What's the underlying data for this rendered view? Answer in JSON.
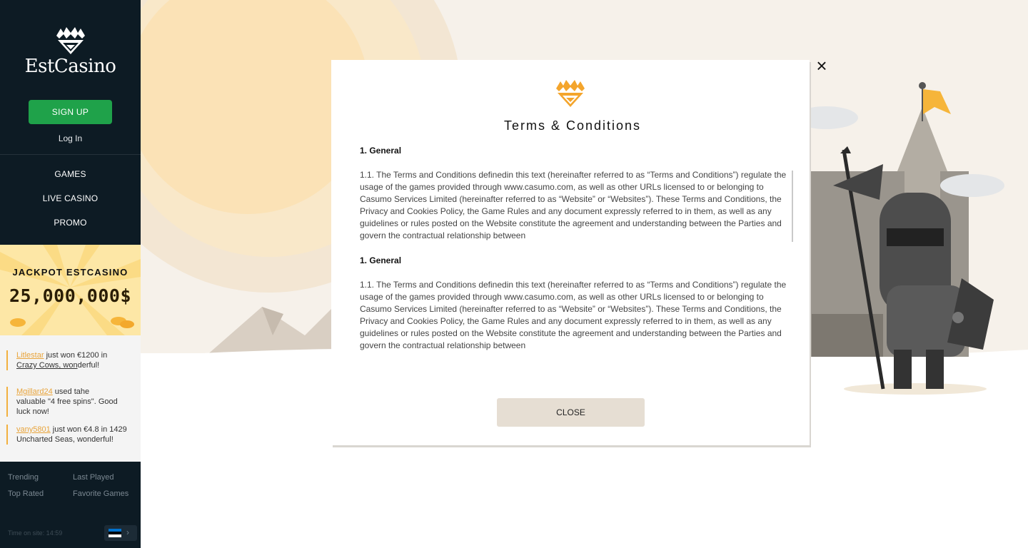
{
  "brand": {
    "name": "EstCasino"
  },
  "sidebar": {
    "signup_label": "SIGN UP",
    "login_label": "Log In",
    "nav": [
      {
        "label": "GAMES"
      },
      {
        "label": "LIVE CASINO"
      },
      {
        "label": "PROMO"
      }
    ],
    "jackpot": {
      "title": "JACKPOT ESTCASINO",
      "amount": "25,000,000$"
    },
    "feed": [
      {
        "user": "Litlestar",
        "pre": " just won €1200 in ",
        "game": "Crazy Cows, won",
        "post": "derful!"
      },
      {
        "user": "Mgillard24",
        "text": " used tahe valuable \"4 free spins\". Good luck now!"
      },
      {
        "user": "vany5801",
        "text": " just won €4.8 in 1429 Uncharted Seas, wonderful!"
      }
    ],
    "links": {
      "trending": "Trending",
      "last_played": "Last Played",
      "top_rated": "Top Rated",
      "favorite_games": "Favorite Games"
    },
    "time_on_site": "Time on site: 14:59",
    "language": {
      "flag_colors": [
        "#0072ce",
        "#000000",
        "#ffffff"
      ]
    }
  },
  "modal": {
    "title": "Terms & Conditions",
    "sections": [
      {
        "heading": "1. General",
        "body": "1.1. The Terms and Conditions definedin this text (hereinafter referred to as “Terms and Conditions”) regulate the usage of the games provided through www.casumo.com, as well as other URLs licensed to or belonging to Casumo Services Limited (hereinafter referred to as “Website” or “Websites”). These Terms and Conditions, the Privacy and Cookies Policy, the Game Rules and any document expressly referred to in them, as well as any guidelines or rules posted on the Website constitute the agreement and understanding between the Parties and govern the contractual relationship between"
      },
      {
        "heading": "1. General",
        "body": "1.1. The Terms and Conditions definedin this text (hereinafter referred to as “Terms and Conditions”) regulate the usage of the games provided through www.casumo.com, as well as other URLs licensed to or belonging to Casumo Services Limited (hereinafter referred to as “Website” or “Websites”). These Terms and Conditions, the Privacy and Cookies Policy, the Game Rules and any document expressly referred to in them, as well as any guidelines or rules posted on the Website constitute the agreement and understanding between the Parties and govern the contractual relationship between"
      }
    ],
    "close_label": "CLOSE",
    "close_icon": "×"
  },
  "colors": {
    "sidebar_bg": "#0d1b24",
    "signup_green": "#1fa24a",
    "accent_orange": "#f2b03e",
    "close_button_bg": "#e6ded3"
  }
}
